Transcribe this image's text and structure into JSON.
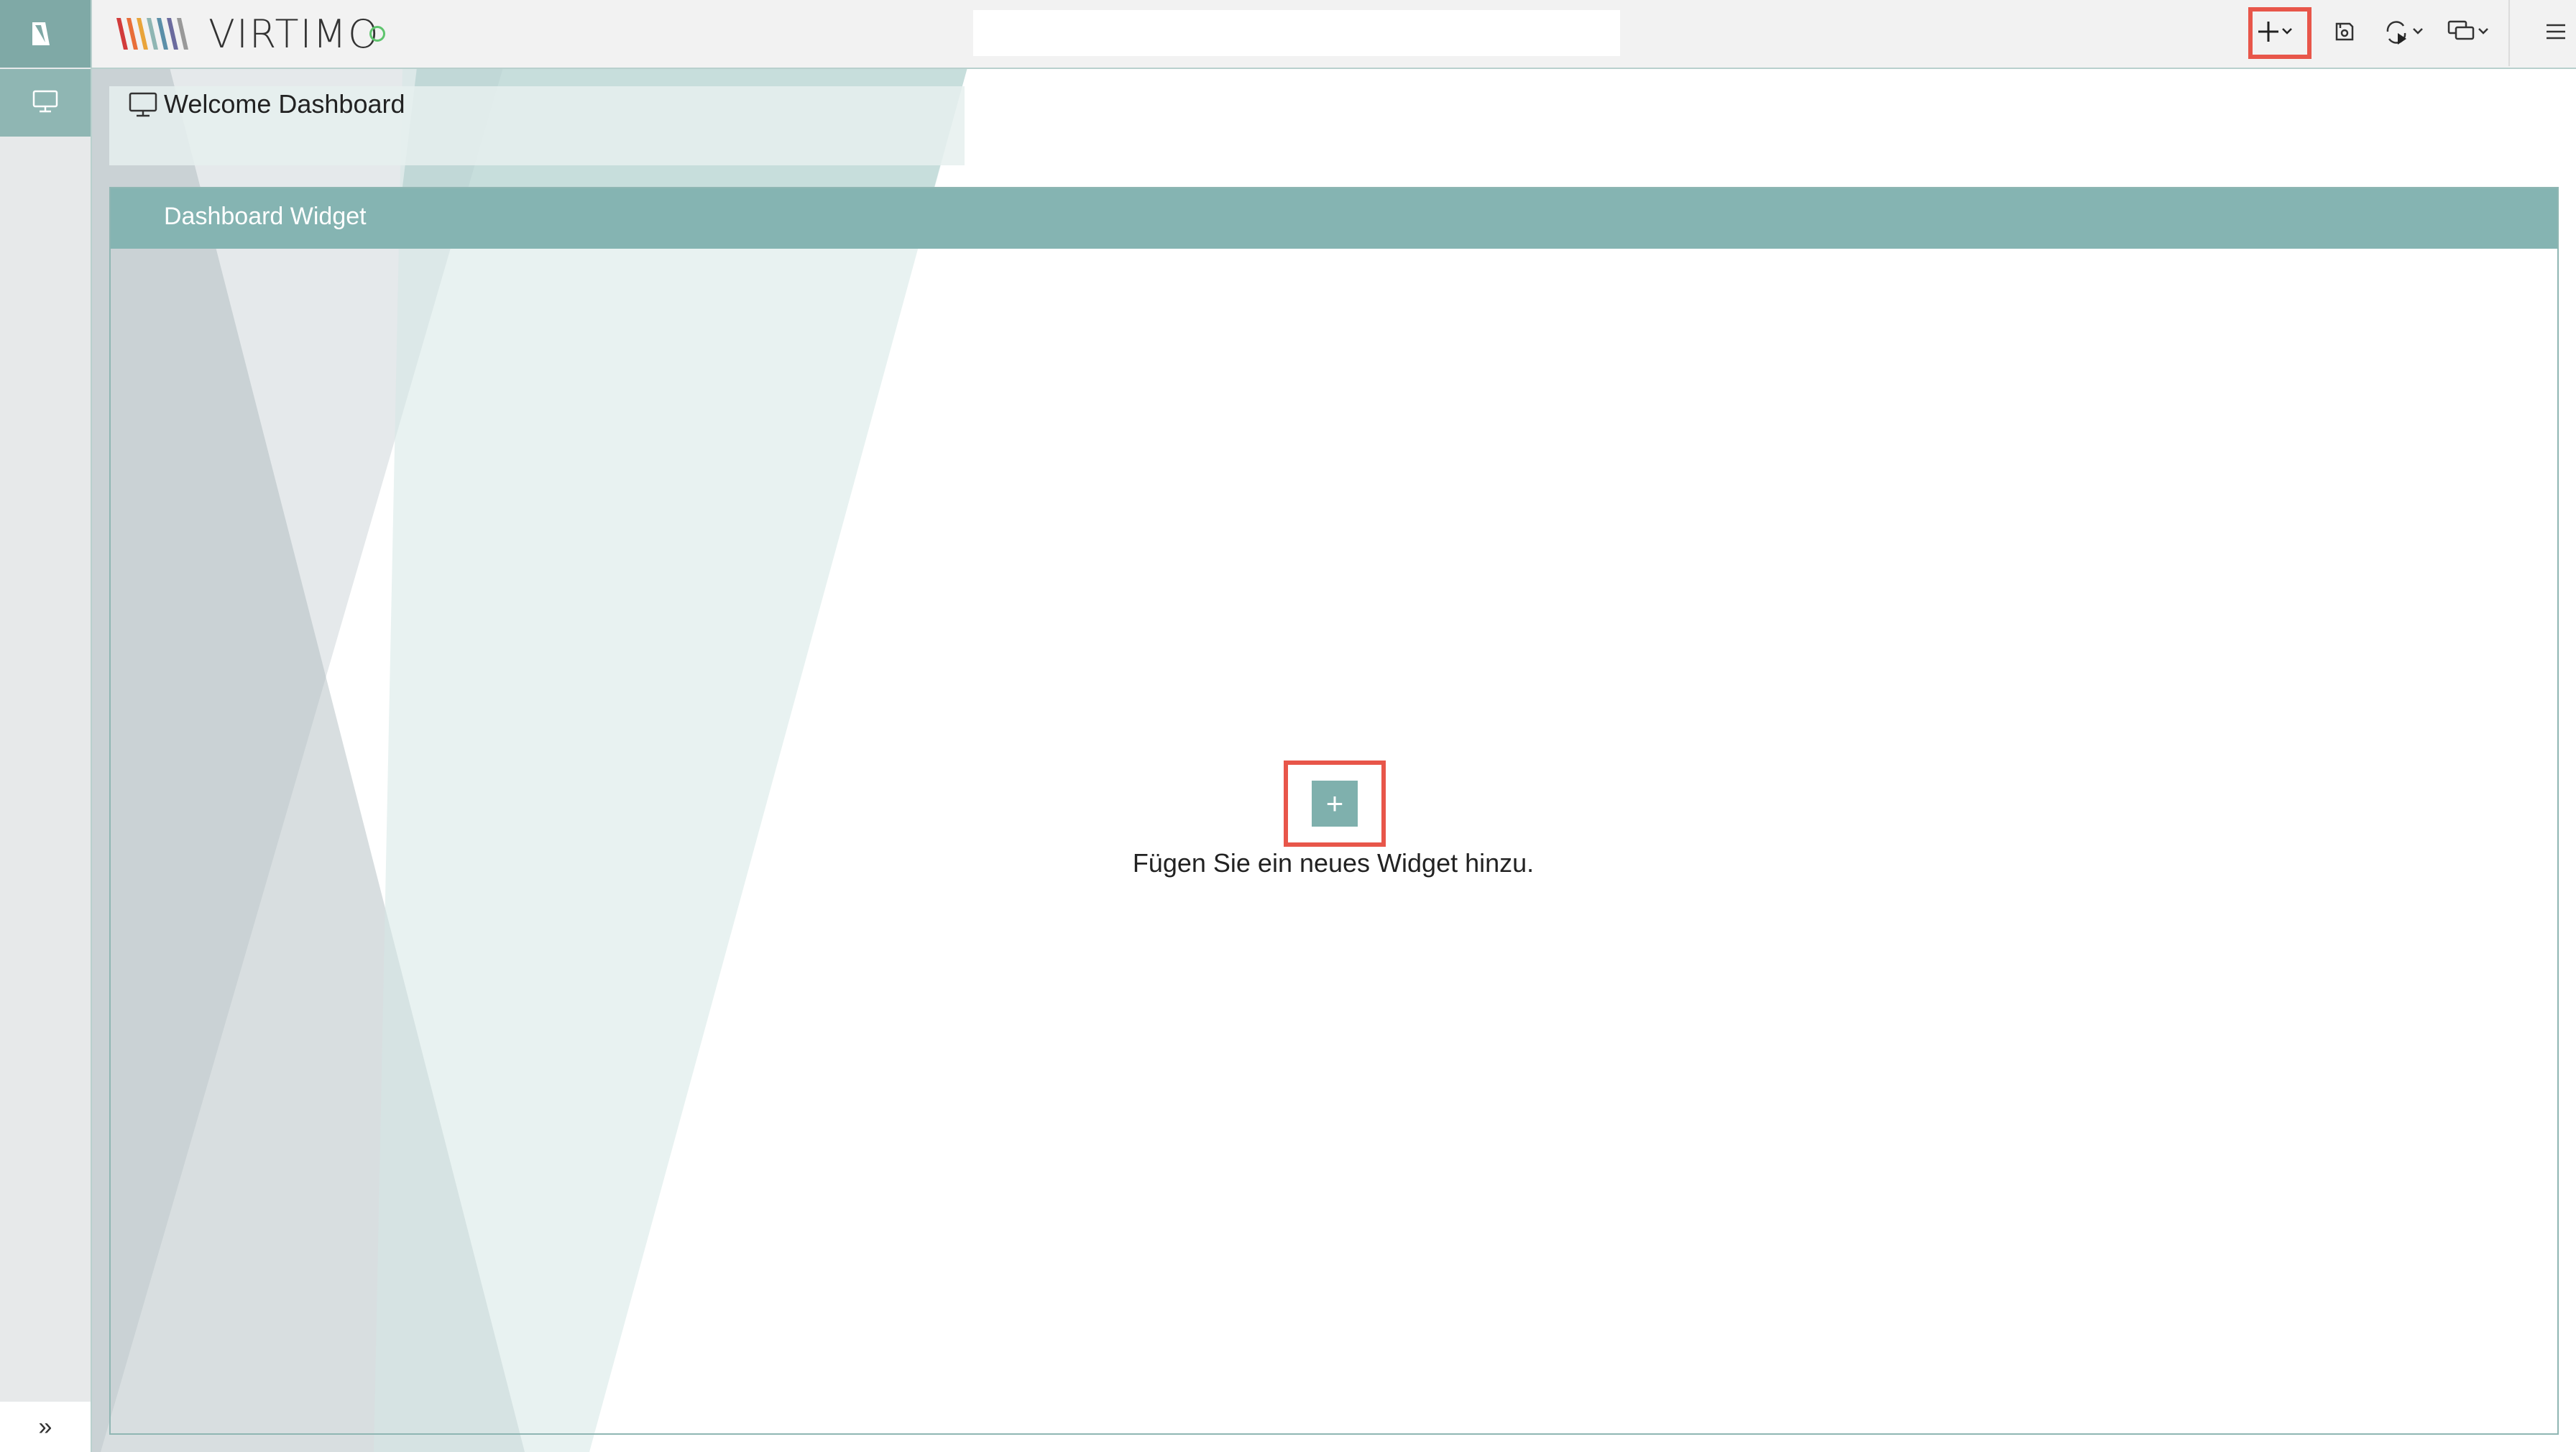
{
  "app": {
    "brand_name": "VIRTIMO",
    "accent_color": "#85b4b2",
    "status": "online"
  },
  "rail": {
    "logo_icon": "virtimo-v-logo-icon",
    "items": [
      {
        "icon": "monitor-icon",
        "active": true
      }
    ],
    "expand_label": "»"
  },
  "topbar": {
    "search_value": "",
    "search_placeholder": "",
    "buttons": [
      {
        "icon": "add-menu-icon",
        "highlighted": true
      },
      {
        "icon": "save-icon"
      },
      {
        "icon": "refresh-play-icon"
      },
      {
        "icon": "chat-menu-icon"
      },
      {
        "icon": "hamburger-menu-icon"
      }
    ]
  },
  "dashboard": {
    "tab_title": "Welcome Dashboard",
    "widget_title": "Dashboard Widget",
    "add_widget_label": "+",
    "add_widget_hint": "Fügen Sie ein neues Widget hinzu."
  }
}
